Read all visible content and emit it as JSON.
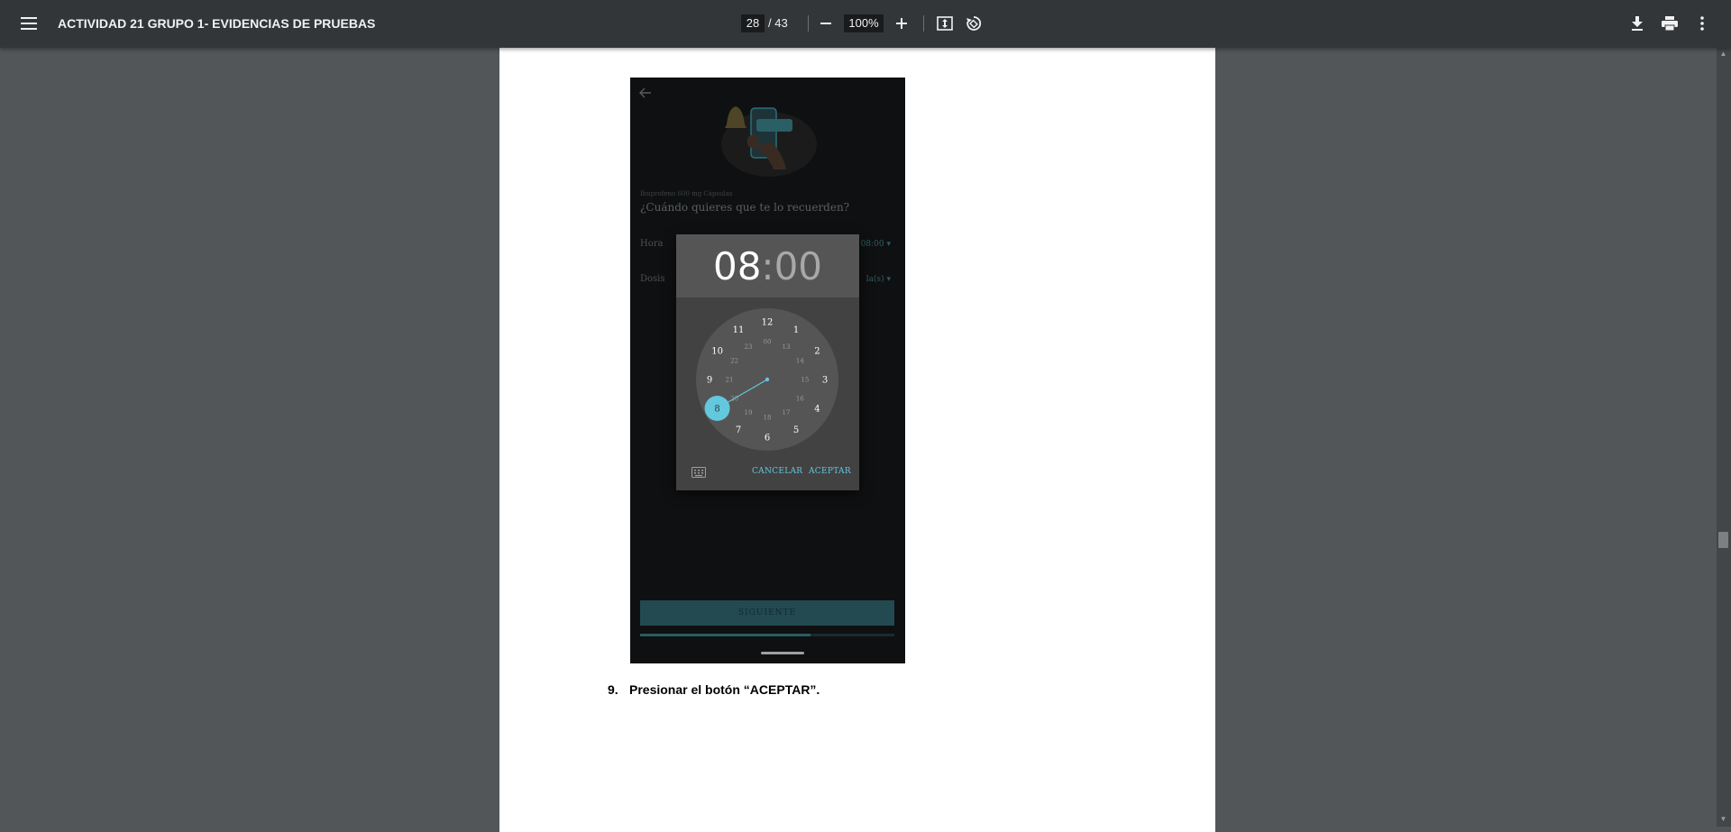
{
  "toolbar": {
    "menu_icon": "hamburger-menu-icon",
    "title": "ACTIVIDAD 21 GRUPO 1- EVIDENCIAS DE PRUEBAS",
    "page_current": "28",
    "page_total": "/ 43",
    "zoom": "100%",
    "zoom_out_icon": "minus-icon",
    "zoom_in_icon": "plus-icon",
    "fit_icon": "fit-to-page-icon",
    "rotate_icon": "rotate-icon",
    "download_icon": "download-icon",
    "print_icon": "print-icon",
    "more_icon": "more-vert-icon"
  },
  "app_screen": {
    "subtitle": "Ibuprofeno 600 mg Cápsulas",
    "question": "¿Cuándo quieres que te lo recuerden?",
    "hora_label": "Hora",
    "hora_value": "08:00 ▾",
    "dosis_label": "Dosis",
    "dosis_value": "la(s) ▾",
    "next_button": "SIGUIENTE",
    "progress": 0.67
  },
  "time_picker": {
    "hours": "08",
    "colon": ":",
    "minutes": "00",
    "outer_numbers": [
      "12",
      "1",
      "2",
      "3",
      "4",
      "5",
      "6",
      "7",
      "8",
      "9",
      "10",
      "11"
    ],
    "inner_numbers": [
      "00",
      "13",
      "14",
      "15",
      "16",
      "17",
      "18",
      "19",
      "20",
      "21",
      "22",
      "23"
    ],
    "selected_hour": "8",
    "cancel_label": "CANCELAR",
    "accept_label": "ACEPTAR",
    "accent_color": "#63c7dd"
  },
  "document": {
    "step_number": "9.",
    "step_text": "Presionar el botón “ACEPTAR”."
  }
}
